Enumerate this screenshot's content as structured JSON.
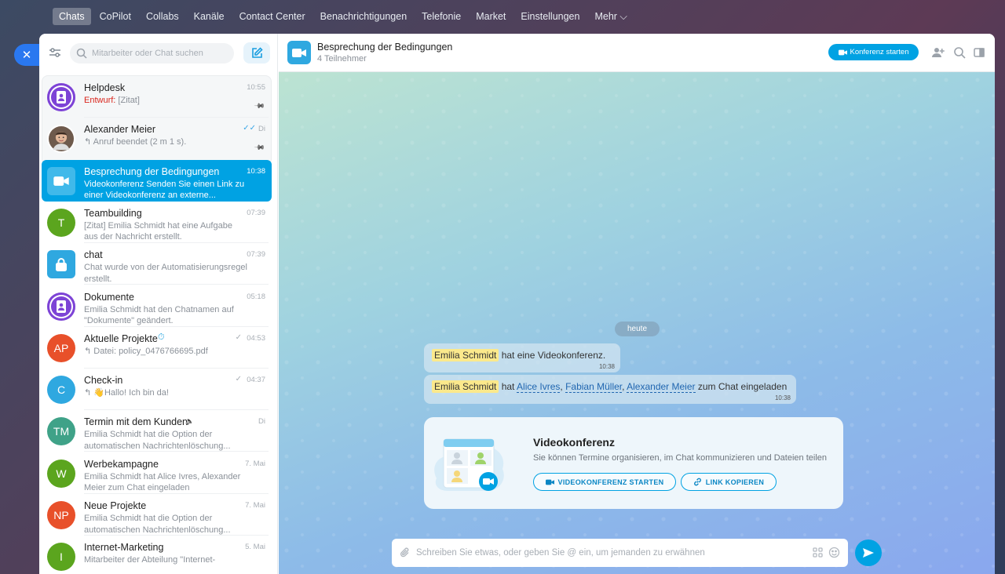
{
  "nav": {
    "items": [
      "Chats",
      "CoPilot",
      "Collabs",
      "Kanäle",
      "Contact Center",
      "Benachrichtigungen",
      "Telefonie",
      "Market",
      "Einstellungen",
      "Mehr ⌵"
    ],
    "active": "Chats"
  },
  "sidebar": {
    "search_placeholder": "Mitarbeiter oder Chat suchen",
    "chats": [
      {
        "name": "Helpdesk",
        "time": "10:55",
        "draft_label": "Entwurf:",
        "preview": " [Zitat]",
        "avatar": "doc-icon",
        "color": "#7d43d6",
        "pinned": true
      },
      {
        "name": "Alexander Meier",
        "time": "Di",
        "preview": "↰ Anruf beendet (2 m 1 s).",
        "avatar": "person-photo",
        "pinned": true,
        "read": true
      },
      {
        "name": "Besprechung der Bedingungen",
        "time": "10:38",
        "preview": "Videokonferenz Senden Sie einen Link zu einer Videokonferenz an externe...",
        "avatar": "video-icon",
        "color": "#2fa8e0",
        "active": true
      },
      {
        "name": "Teambuilding",
        "time": "07:39",
        "preview": "[Zitat] Emilia Schmidt hat eine Aufgabe aus der Nachricht erstellt.",
        "avatar_text": "T",
        "color": "#5ba51e"
      },
      {
        "name": "chat",
        "time": "07:39",
        "preview": "Chat wurde von der Automatisierungsregel erstellt.",
        "avatar": "lock-icon",
        "color": "#2fa8e0"
      },
      {
        "name": "Dokumente",
        "time": "05:18",
        "preview": "Emilia Schmidt hat den Chatnamen auf \"Dokumente\" geändert.",
        "avatar": "doc-icon",
        "color": "#7d43d6"
      },
      {
        "name": "Aktuelle Projekte",
        "time": "04:53",
        "preview": "↰ Datei: policy_0476766695.pdf",
        "avatar_text": "AP",
        "color": "#e8502a",
        "read": true
      },
      {
        "name": "Check-in",
        "time": "04:37",
        "preview": "↰ 👋Hallo! Ich bin da!",
        "avatar_text": "C",
        "color": "#2fa8e0",
        "read": true
      },
      {
        "name": "Termin mit dem Kunden",
        "time": "Di",
        "preview": "Emilia Schmidt hat die Option der automatischen Nachrichtenlöschung...",
        "avatar_text": "TM",
        "color": "#3fa288",
        "muted": true
      },
      {
        "name": "Werbekampagne",
        "time": "7. Mai",
        "preview": "Emilia Schmidt hat Alice Ivres, Alexander Meier zum Chat eingeladen",
        "avatar_text": "W",
        "color": "#5ba51e"
      },
      {
        "name": "Neue Projekte",
        "time": "7. Mai",
        "preview": "Emilia Schmidt hat die Option der automatischen Nachrichtenlöschung...",
        "avatar_text": "NP",
        "color": "#e8502a"
      },
      {
        "name": "Internet-Marketing",
        "time": "5. Mai",
        "preview": "Mitarbeiter der Abteilung \"Internet-",
        "avatar_text": "I",
        "color": "#5ba51e"
      }
    ]
  },
  "header": {
    "title": "Besprechung der Bedingungen",
    "subtitle": "4 Teilnehmer",
    "start_conference": "Konferenz starten"
  },
  "messages": {
    "date": "heute",
    "msg1": {
      "who": "Emilia Schmidt",
      "text": " hat eine Videokonferenz.",
      "time": "10:38"
    },
    "msg2": {
      "who": "Emilia Schmidt",
      "pre": " hat ",
      "u1": "Alice Ivres",
      "c1": ", ",
      "u2": "Fabian Müller",
      "c2": ", ",
      "u3": "Alexander Meier",
      "post": " zum Chat eingeladen",
      "time": "10:38"
    }
  },
  "card": {
    "title": "Videokonferenz",
    "subtitle": "Sie können Termine organisieren, im Chat kommunizieren und Dateien teilen",
    "btn_start": "VIDEOKONFERENZ STARTEN",
    "btn_copy": "LINK KOPIEREN"
  },
  "composer": {
    "placeholder": "Schreiben Sie etwas, oder geben Sie @ ein, um jemanden zu erwähnen"
  },
  "colors": {
    "accent": "#00a2e3",
    "draft": "#d9251c",
    "highlight": "#fbe98c"
  }
}
